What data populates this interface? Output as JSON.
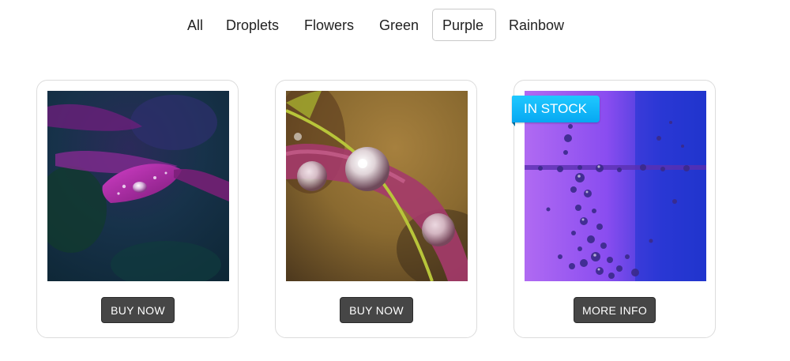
{
  "filters": [
    {
      "label": "All",
      "active": false
    },
    {
      "label": "Droplets",
      "active": false
    },
    {
      "label": "Flowers",
      "active": false
    },
    {
      "label": "Green",
      "active": false
    },
    {
      "label": "Purple",
      "active": true
    },
    {
      "label": "Rainbow",
      "active": false
    }
  ],
  "cards": [
    {
      "image": "purple-petal-with-droplets",
      "button_label": "BUY NOW",
      "badge": null
    },
    {
      "image": "droplets-on-pink-stem",
      "button_label": "BUY NOW",
      "badge": null
    },
    {
      "image": "purple-water-bubbles",
      "button_label": "MORE INFO",
      "badge": "IN STOCK"
    }
  ],
  "colors": {
    "button_bg": "#464646",
    "badge_bg": "#07a8f2",
    "active_filter_border": "#c9c9c9"
  }
}
